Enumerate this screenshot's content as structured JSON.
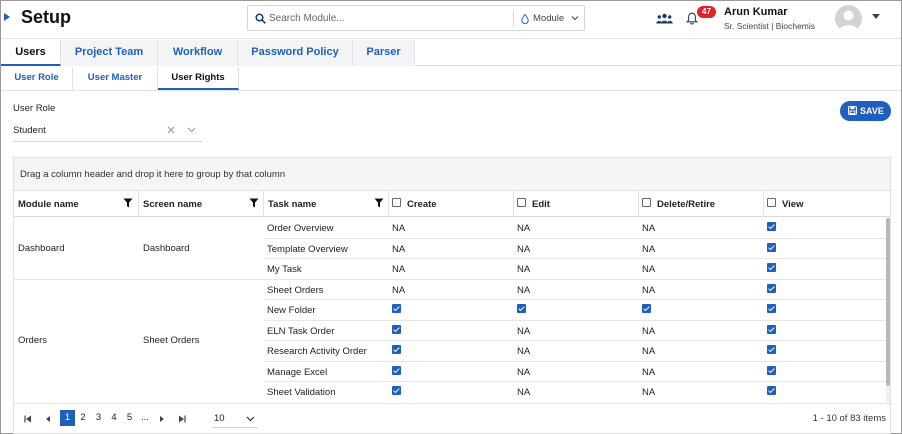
{
  "header": {
    "title": "Setup",
    "search_placeholder": "Search Module...",
    "module_label": "Module",
    "notification_count": "47",
    "user_name": "Arun Kumar",
    "user_role": "Sr. Scientist | Biochemis"
  },
  "main_tabs": [
    {
      "label": "Users",
      "active": true
    },
    {
      "label": "Project Team",
      "active": false
    },
    {
      "label": "Workflow",
      "active": false
    },
    {
      "label": "Password Policy",
      "active": false
    },
    {
      "label": "Parser",
      "active": false
    }
  ],
  "sub_tabs": [
    {
      "label": "User Role",
      "active": false
    },
    {
      "label": "User Master",
      "active": false
    },
    {
      "label": "User Rights",
      "active": true
    }
  ],
  "role": {
    "label": "User Role",
    "value": "Student"
  },
  "save_label": "SAVE",
  "grid": {
    "group_panel_text": "Drag a column header and drop it here to group by that column",
    "columns": [
      "Module name",
      "Screen name",
      "Task name",
      "Create",
      "Edit",
      "Delete/Retire",
      "View"
    ],
    "groups": [
      {
        "module": "Dashboard",
        "screen": "Dashboard",
        "start": 0,
        "count": 3
      },
      {
        "module": "Orders",
        "screen": "Sheet Orders",
        "start": 3,
        "count": 6
      }
    ],
    "rows": [
      {
        "task": "Order Overview",
        "create": "NA",
        "edit": "NA",
        "delete": "NA",
        "view": true
      },
      {
        "task": "Template Overview",
        "create": "NA",
        "edit": "NA",
        "delete": "NA",
        "view": true
      },
      {
        "task": "My Task",
        "create": "NA",
        "edit": "NA",
        "delete": "NA",
        "view": true
      },
      {
        "task": "Sheet Orders",
        "create": "NA",
        "edit": "NA",
        "delete": "NA",
        "view": true
      },
      {
        "task": "New Folder",
        "create": true,
        "edit": true,
        "delete": true,
        "view": true
      },
      {
        "task": "ELN Task Order",
        "create": true,
        "edit": "NA",
        "delete": "NA",
        "view": true
      },
      {
        "task": "Research Activity Order",
        "create": true,
        "edit": "NA",
        "delete": "NA",
        "view": true
      },
      {
        "task": "Manage Excel",
        "create": true,
        "edit": "NA",
        "delete": "NA",
        "view": true
      },
      {
        "task": "Sheet Validation",
        "create": true,
        "edit": "NA",
        "delete": "NA",
        "view": true
      }
    ]
  },
  "pager": {
    "pages": [
      "1",
      "2",
      "3",
      "4",
      "5",
      "..."
    ],
    "current_page": "1",
    "page_size": "10",
    "info": "1 - 10 of 83 items"
  },
  "colors": {
    "accent": "#1f5fbf",
    "badge": "#e4202a"
  }
}
